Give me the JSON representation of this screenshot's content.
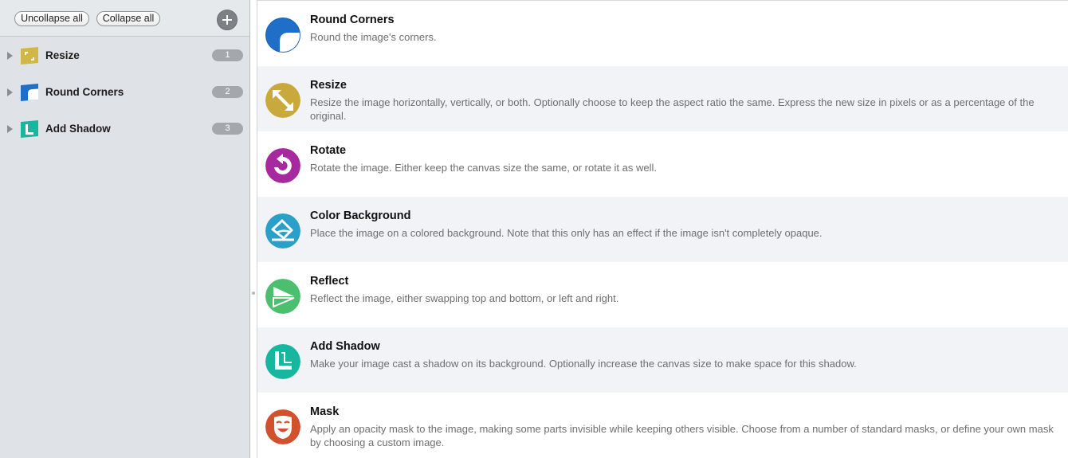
{
  "sidebar": {
    "toolbar": {
      "uncollapse_label": "Uncollapse all",
      "collapse_label": "Collapse all",
      "add_icon": "plus-icon"
    },
    "items": [
      {
        "label": "Resize",
        "count": "1",
        "icon": "resize-icon",
        "color": "#c9a93b"
      },
      {
        "label": "Round Corners",
        "count": "2",
        "icon": "round-corners-icon",
        "color": "#1f6fc9"
      },
      {
        "label": "Add Shadow",
        "count": "3",
        "icon": "add-shadow-icon",
        "color": "#17b79f"
      }
    ]
  },
  "actions": [
    {
      "title": "Round Corners",
      "description": "Round the image's corners.",
      "icon": "round-corners-icon",
      "color": "#1f6fc9"
    },
    {
      "title": "Resize",
      "description": "Resize the image horizontally, vertically, or both. Optionally choose to keep the aspect ratio the same. Express the new size in pixels or as a percentage of the original.",
      "icon": "resize-icon",
      "color": "#c9a93b"
    },
    {
      "title": "Rotate",
      "description": "Rotate the image. Either keep the canvas size the same, or rotate it as well.",
      "icon": "rotate-icon",
      "color": "#a629a0"
    },
    {
      "title": "Color Background",
      "description": "Place the image on a colored background. Note that this only has an effect if the image isn't completely opaque.",
      "icon": "paint-bucket-icon",
      "color": "#2aa0c8"
    },
    {
      "title": "Reflect",
      "description": "Reflect the image, either swapping top and bottom, or left and right.",
      "icon": "reflect-icon",
      "color": "#4cbf6e"
    },
    {
      "title": "Add Shadow",
      "description": "Make your image cast a shadow on its background. Optionally increase the canvas size to make space for this shadow.",
      "icon": "add-shadow-icon",
      "color": "#17b79f"
    },
    {
      "title": "Mask",
      "description": "Apply an opacity mask to the image, making some parts invisible while keeping others visible. Choose from a number of standard masks, or define your own mask by choosing a custom image.",
      "icon": "mask-icon",
      "color": "#d0512c"
    }
  ]
}
